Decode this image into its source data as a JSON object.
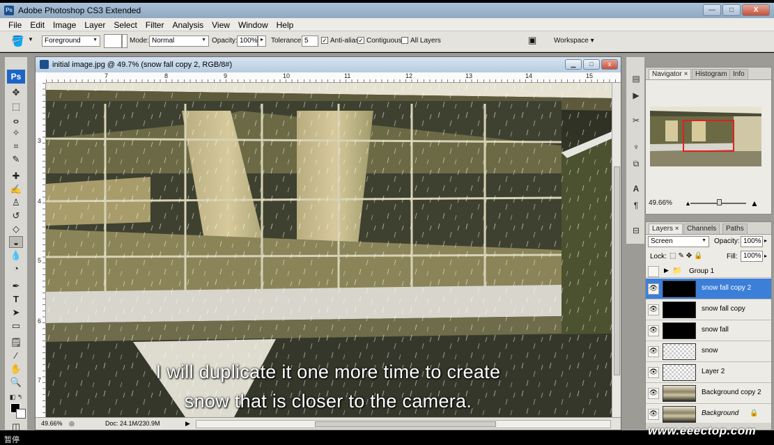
{
  "window": {
    "title": "Adobe Photoshop CS3 Extended",
    "app_icon": "Ps",
    "controls": [
      "—",
      "□",
      "X"
    ]
  },
  "menu": [
    "File",
    "Edit",
    "Image",
    "Layer",
    "Select",
    "Filter",
    "Analysis",
    "View",
    "Window",
    "Help"
  ],
  "options": {
    "fill_source": "Foreground",
    "mode_label": "Mode:",
    "mode_value": "Normal",
    "opacity_label": "Opacity:",
    "opacity_value": "100%",
    "tolerance_label": "Tolerance:",
    "tolerance_value": "5",
    "anti_alias": "Anti-alias",
    "contiguous": "Contiguous",
    "all_layers": "All Layers",
    "workspace": "Workspace ▾"
  },
  "toolbox": {
    "logo": "Ps"
  },
  "document": {
    "title": "initial image.jpg @ 49.7% (snow fall copy 2, RGB/8#)",
    "ruler_h": [
      "7",
      "8",
      "9",
      "10",
      "11",
      "12",
      "13",
      "14",
      "15",
      "16"
    ],
    "ruler_v": [
      "3",
      "4",
      "5",
      "6",
      "7"
    ],
    "zoom": "49.66%",
    "doc_info": "Doc: 24.1M/230.9M"
  },
  "navigator": {
    "tabs": [
      "Navigator",
      "Histogram",
      "Info"
    ],
    "zoom": "49.66%"
  },
  "layers": {
    "tabs": [
      "Layers",
      "Channels",
      "Paths"
    ],
    "blend_mode": "Screen",
    "opacity_label": "Opacity:",
    "opacity_value": "100%",
    "lock_label": "Lock:",
    "fill_label": "Fill:",
    "fill_value": "100%",
    "group": "Group 1",
    "items": [
      {
        "name": "snow fall copy 2",
        "thumb": "black"
      },
      {
        "name": "snow fall copy",
        "thumb": "black"
      },
      {
        "name": "snow fall",
        "thumb": "black"
      },
      {
        "name": "snow",
        "thumb": "checker"
      },
      {
        "name": "Layer 2",
        "thumb": "checker"
      },
      {
        "name": "Background copy 2",
        "thumb": "photo"
      },
      {
        "name": "Background",
        "thumb": "photo"
      }
    ]
  },
  "subtitle": {
    "line1": "I will duplicate it one more time to create",
    "line2": "snow that is closer to the camera."
  },
  "overlay": {
    "watermark": "www.eeectop.com",
    "status": "暂停"
  }
}
